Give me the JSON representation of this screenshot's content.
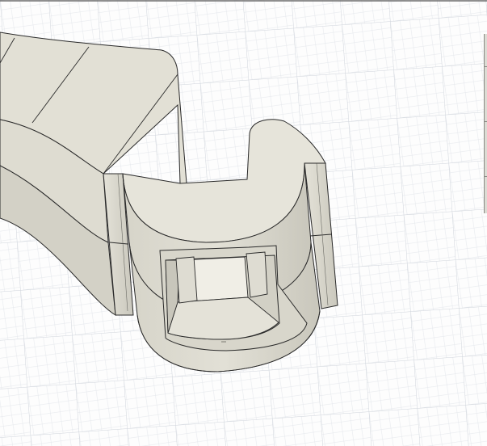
{
  "viewport": {
    "label": "",
    "background": "#fdfdfd",
    "grid": {
      "minor_color": "#e2e5ea",
      "major_color": "#cdd2d9"
    }
  },
  "model": {
    "face_light": "#e6e4da",
    "face_mid": "#dcdad0",
    "face_shadow": "#cfcdc2",
    "face_dark": "#bcbab0",
    "edge_color": "#2a2a2a"
  },
  "side_panel": {
    "color": "#dcdcd4",
    "partially_visible": true
  }
}
